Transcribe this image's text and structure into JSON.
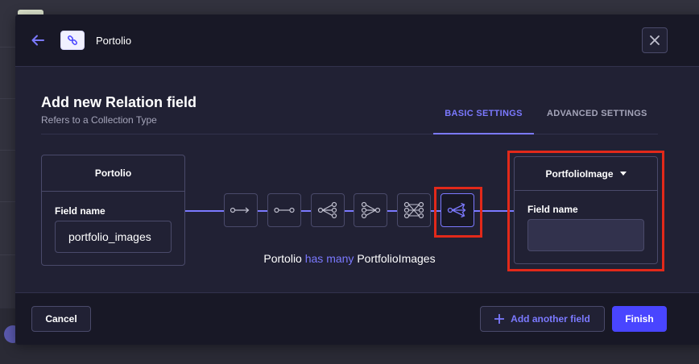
{
  "header": {
    "title": "Portolio",
    "back_icon": "arrow-left-icon",
    "content_type_icon": "link-icon",
    "close_icon": "close-icon"
  },
  "main": {
    "title": "Add new Relation field",
    "subtitle": "Refers to a Collection Type"
  },
  "tabs": [
    {
      "label": "BASIC SETTINGS",
      "active": true
    },
    {
      "label": "ADVANCED SETTINGS",
      "active": false
    }
  ],
  "left_card": {
    "title": "Portolio",
    "field_label": "Field name",
    "field_value": "portfolio_images"
  },
  "right_card": {
    "title": "PortfolioImage",
    "dropdown_icon": "caret-down-icon",
    "field_label": "Field name",
    "field_value": ""
  },
  "relation_types": [
    {
      "name": "one-way",
      "active": false
    },
    {
      "name": "one-to-one",
      "active": false
    },
    {
      "name": "one-to-many",
      "active": false
    },
    {
      "name": "many-to-one",
      "active": false
    },
    {
      "name": "many-to-many",
      "active": false
    },
    {
      "name": "many-way",
      "active": true
    }
  ],
  "relation_sentence": {
    "left": "Portolio",
    "relation": "has many",
    "right": "PortfolioImages"
  },
  "footer": {
    "cancel_label": "Cancel",
    "add_another_label": "Add another field",
    "finish_label": "Finish"
  },
  "colors": {
    "accent": "#7b79ff",
    "primary_button": "#4945ff",
    "highlight_box": "#e2291a",
    "modal_bg": "#212134",
    "header_bg": "#181826"
  }
}
